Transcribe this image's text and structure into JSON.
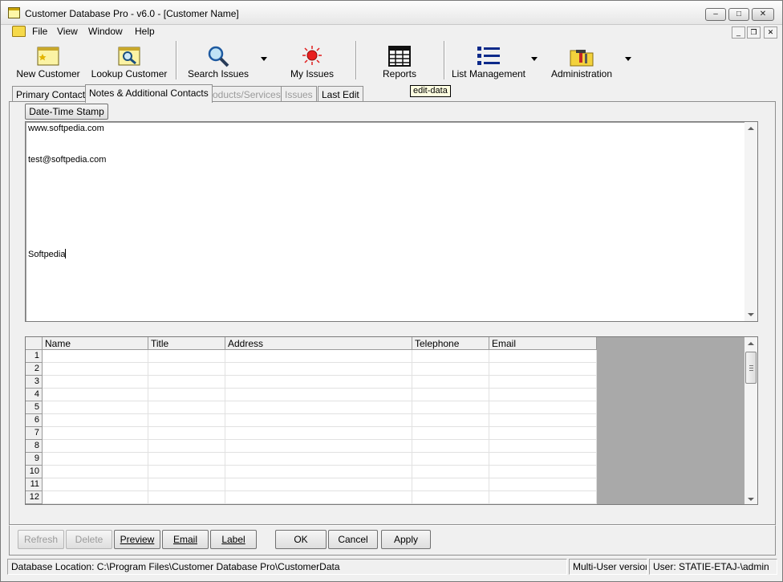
{
  "window": {
    "title": "Customer Database Pro - v6.0 - [Customer Name]",
    "minimize_glyph": "–",
    "maximize_glyph": "□",
    "close_glyph": "✕"
  },
  "menu": {
    "items": [
      "File",
      "View",
      "Window",
      "Help"
    ],
    "mdi_minimize_glyph": "_",
    "mdi_restore_glyph": "❐",
    "mdi_close_glyph": "✕"
  },
  "toolbar": {
    "new_customer": "New Customer",
    "lookup_customer": "Lookup Customer",
    "search_issues": "Search Issues",
    "my_issues": "My Issues",
    "reports": "Reports",
    "list_management": "List Management",
    "administration": "Administration",
    "icons": {
      "new_customer": "star-card-icon",
      "lookup_customer": "magnifier-card-icon",
      "search_issues": "magnifier-icon",
      "my_issues": "red-light-icon",
      "reports": "report-grid-icon",
      "list_management": "list-icon",
      "administration": "tools-folder-icon"
    }
  },
  "tooltip": "edit-data",
  "tabs": [
    {
      "label": "Primary Contact",
      "state": "normal"
    },
    {
      "label": "Notes & Additional Contacts",
      "state": "active"
    },
    {
      "label": "Products/Services",
      "state": "disabled"
    },
    {
      "label": "Issues",
      "state": "disabled"
    },
    {
      "label": "Last Edit",
      "state": "normal"
    }
  ],
  "notes_panel": {
    "datetime_button": "Date-Time Stamp",
    "lines": [
      {
        "text": "www.softpedia.com"
      },
      {
        "text": "test@softpedia.com"
      },
      {
        "text": "Softpedia"
      }
    ]
  },
  "contacts_grid": {
    "columns": [
      "Name",
      "Title",
      "Address",
      "Telephone",
      "Email"
    ],
    "rows": [
      "1",
      "2",
      "3",
      "4",
      "5",
      "6",
      "7",
      "8",
      "9",
      "10",
      "11",
      "12"
    ]
  },
  "buttons": {
    "refresh": "Refresh",
    "delete": "Delete",
    "preview": "Preview",
    "email": "Email",
    "label": "Label",
    "ok": "OK",
    "cancel": "Cancel",
    "apply": "Apply"
  },
  "status": {
    "database_location": "Database Location: C:\\Program Files\\Customer Database Pro\\CustomerData",
    "version_mode": "Multi-User version",
    "user": "User: STATIE-ETAJ-\\admin"
  },
  "colors": {
    "grid_background": "#a9a9a9",
    "tooltip_background": "#ffffe1",
    "disabled_text": "#9a9a9a"
  }
}
